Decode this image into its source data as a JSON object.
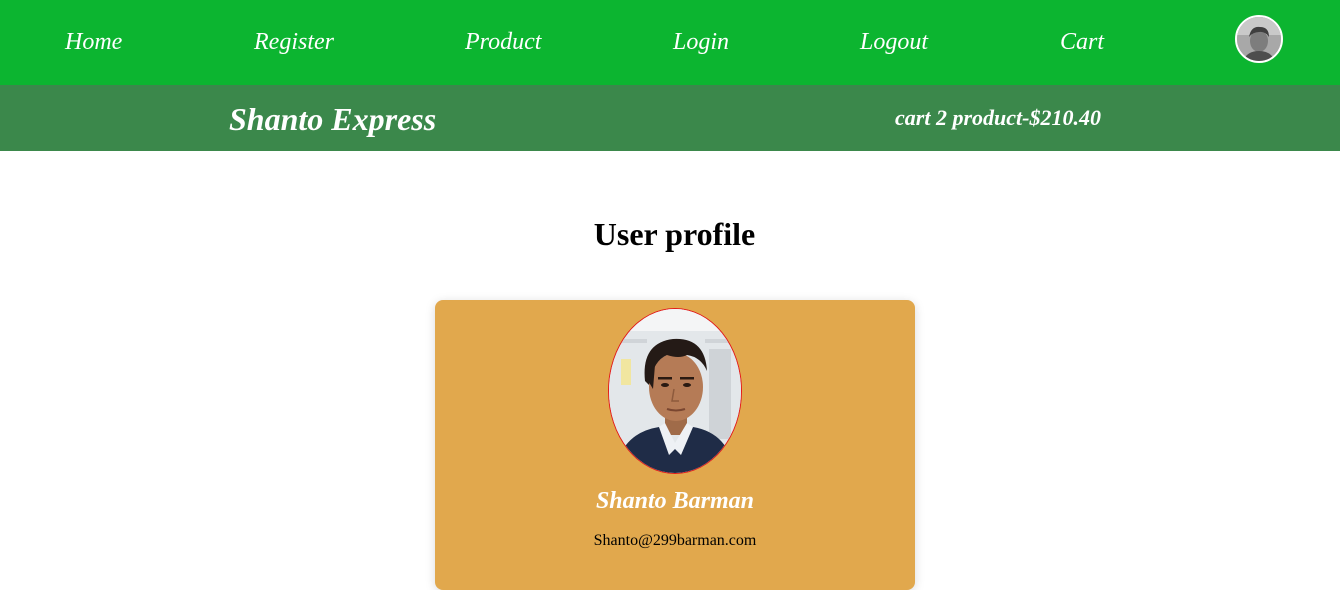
{
  "nav": {
    "items": [
      {
        "label": "Home"
      },
      {
        "label": "Register"
      },
      {
        "label": "Product"
      },
      {
        "label": "Login"
      },
      {
        "label": "Logout"
      },
      {
        "label": "Cart"
      }
    ],
    "avatar_icon": "user-avatar-icon"
  },
  "header": {
    "brand": "Shanto Express",
    "cart_summary": "cart 2 product-$210.40"
  },
  "main": {
    "title": "User profile",
    "profile": {
      "name": "Shanto Barman",
      "email": "Shanto@299barman.com",
      "photo_icon": "profile-photo"
    }
  },
  "colors": {
    "nav_bg": "#0cb530",
    "subbar_bg": "#3b884b",
    "card_bg": "#e1a84d",
    "photo_border": "#e31b1b"
  }
}
